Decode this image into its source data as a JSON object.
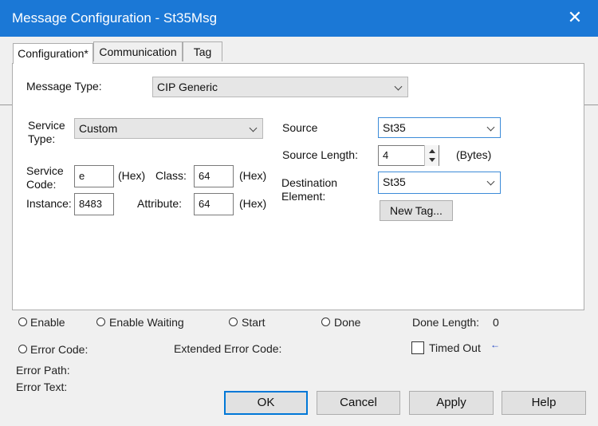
{
  "window": {
    "title": "Message Configuration - St35Msg",
    "close_glyph": "✕"
  },
  "tabs": [
    {
      "label": "Configuration*"
    },
    {
      "label": "Communication"
    },
    {
      "label": "Tag"
    }
  ],
  "config": {
    "message_type_label": "Message Type:",
    "message_type_value": "CIP Generic",
    "service_type_label_1": "Service",
    "service_type_label_2": "Type:",
    "service_type_value": "Custom",
    "service_code_label_1": "Service",
    "service_code_label_2": "Code:",
    "service_code_value": "e",
    "hex_label": "(Hex)",
    "class_label": "Class:",
    "class_value": "64",
    "instance_label": "Instance:",
    "instance_value": "8483",
    "attribute_label": "Attribute:",
    "attribute_value": "64",
    "source_label": "Source",
    "source_value": "St35",
    "source_length_label": "Source Length:",
    "source_length_value": "4",
    "bytes_label": "(Bytes)",
    "destination_label_1": "Destination",
    "destination_label_2": "Element:",
    "destination_value": "St35",
    "new_tag_label": "New Tag..."
  },
  "status": {
    "enable": "Enable",
    "enable_waiting": "Enable Waiting",
    "start": "Start",
    "done": "Done",
    "done_length_label": "Done Length:",
    "done_length_value": "0",
    "error_code": "Error Code:",
    "extended_error_code": "Extended Error Code:",
    "timed_out": "Timed Out",
    "timed_out_arrow": "←",
    "error_path": "Error Path:",
    "error_text": "Error Text:"
  },
  "buttons": {
    "ok": "OK",
    "cancel": "Cancel",
    "apply": "Apply",
    "help": "Help"
  },
  "colors": {
    "title_bar": "#1b78d6",
    "dialog_bg": "#f0f0f0",
    "focus_border": "#0078d7",
    "arrow": "#1a3fc4"
  }
}
